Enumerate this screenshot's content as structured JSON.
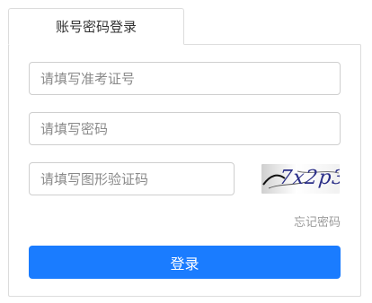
{
  "tab": {
    "label": "账号密码登录"
  },
  "form": {
    "account_placeholder": "请填写准考证号",
    "password_placeholder": "请填写密码",
    "captcha_placeholder": "请填写图形验证码",
    "captcha_text": "7x2p3",
    "forgot_label": "忘记密码",
    "submit_label": "登录"
  },
  "colors": {
    "primary": "#1a7cff",
    "border": "#dcdcdc",
    "muted_text": "#9a9a9a",
    "captcha_ink": "#2b2f88"
  }
}
